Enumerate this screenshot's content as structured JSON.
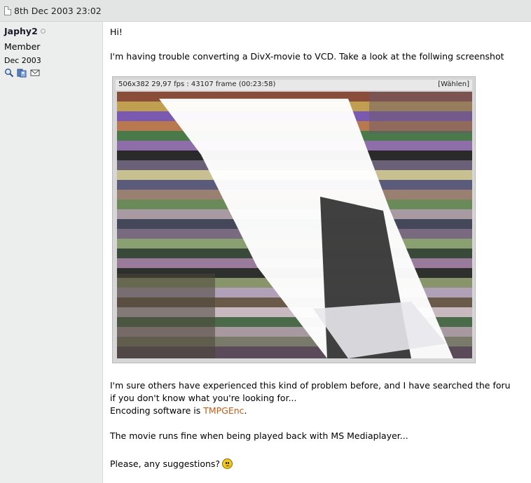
{
  "post": {
    "date": "8th Dec 2003 23:02"
  },
  "user": {
    "name": "Japhy2",
    "title": "Member",
    "join_date": "Dec 2003",
    "icons": [
      "search-posts-icon",
      "contacts-icon",
      "email-icon"
    ]
  },
  "message": {
    "greeting": "Hi!",
    "line1": "I'm having trouble converting a DivX-movie to VCD. Take a look at the follwing screenshot",
    "line2": "I'm sure others have experienced this kind of problem before, and I have searched the foru",
    "line3": "if you don't know what you're looking for...",
    "line4_prefix": "Encoding software is ",
    "line4_link": "TMPGEnc",
    "line4_suffix": ".",
    "line5": "The movie runs fine when being played back with MS Mediaplayer...",
    "line6": "Please, any suggestions?",
    "smiley": "frown-smiley"
  },
  "screenshot": {
    "info": "506x382 29,97 fps : 43107 frame (00:23:58)",
    "choose": "[Wählen]"
  },
  "colors": {
    "header_bg": "#e3e5e5",
    "sidebar_bg": "#eceeee",
    "link": "#c85a16"
  }
}
